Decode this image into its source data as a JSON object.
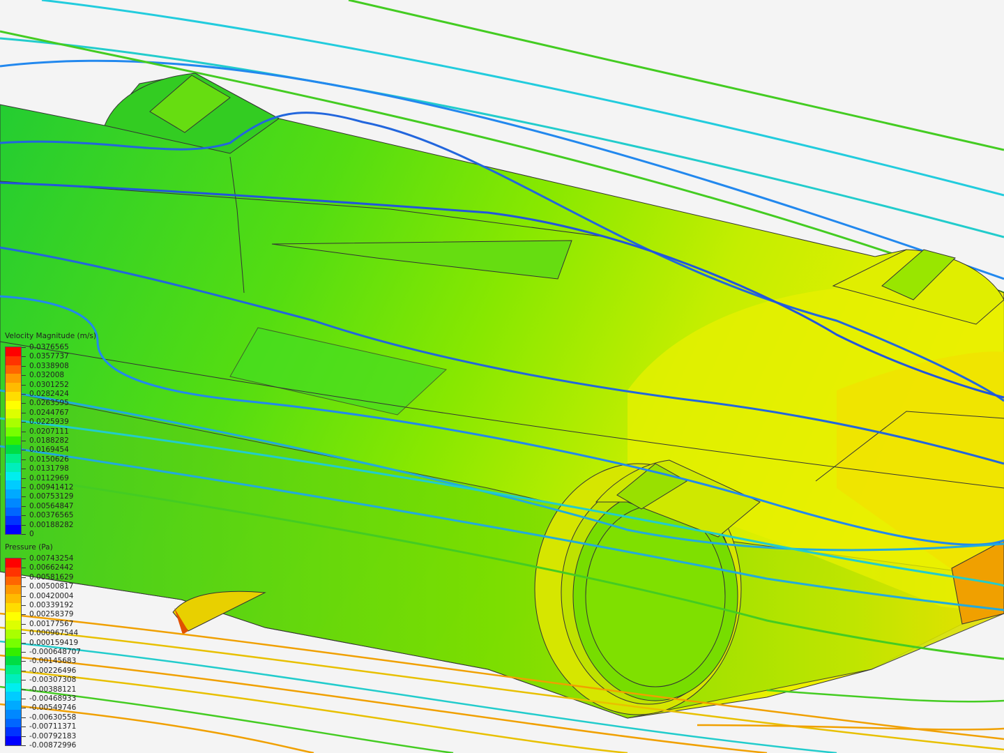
{
  "velocity_legend": {
    "title": "Velocity Magnitude (m/s)",
    "labels": [
      "0.0376565",
      "0.0357737",
      "0.0338908",
      "0.032008",
      "0.0301252",
      "0.0282424",
      "0.0263595",
      "0.0244767",
      "0.0225939",
      "0.0207111",
      "0.0188282",
      "0.0169454",
      "0.0150626",
      "0.0131798",
      "0.0112969",
      "0.00941412",
      "0.00753129",
      "0.00564847",
      "0.00376565",
      "0.00188282",
      "0"
    ]
  },
  "pressure_legend": {
    "title": "Pressure (Pa)",
    "labels": [
      "0.00743254",
      "0.00662442",
      "0.00581629",
      "0.00500817",
      "0.00420004",
      "0.00339192",
      "0.00258379",
      "0.00177567",
      "0.000967544",
      "0.000159419",
      "-0.000648707",
      "-0.00145683",
      "-0.00226496",
      "-0.00307308",
      "-0.00388121",
      "-0.00468933",
      "-0.00549746",
      "-0.00630558",
      "-0.00711371",
      "-0.00792183",
      "-0.00872996"
    ]
  },
  "colors": {
    "scale": [
      "#ff0000",
      "#ff3300",
      "#ff6600",
      "#ff9900",
      "#ffbb00",
      "#ffdd00",
      "#ffff00",
      "#ddff00",
      "#aaff00",
      "#77ff00",
      "#33ee00",
      "#00dd44",
      "#00ee88",
      "#00eebb",
      "#00eeee",
      "#00ccff",
      "#00aaff",
      "#0088ff",
      "#0066ff",
      "#0033ff",
      "#0000ff"
    ],
    "background": "#f4f4f4",
    "body_green": "#7fe600",
    "body_yellow": "#e6f000"
  }
}
